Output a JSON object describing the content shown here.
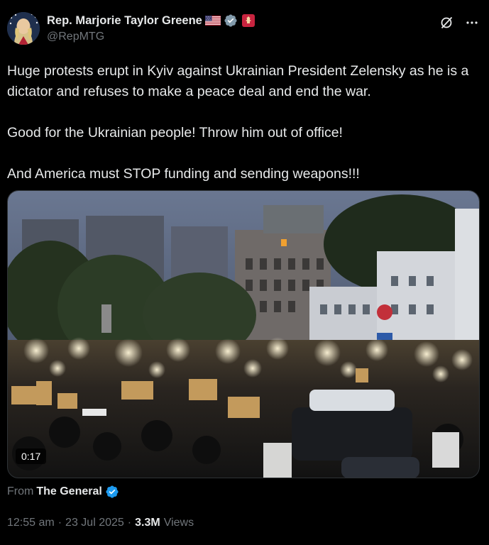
{
  "author": {
    "display_name": "Rep. Marjorie Taylor Greene",
    "handle": "@RepMTG",
    "flag_icon": "us-flag-icon",
    "verified_icon": "gray-verified-badge-icon",
    "affiliate_icon": "house-seal-icon"
  },
  "actions": {
    "grok_icon": "grok-icon",
    "more_icon": "more-icon"
  },
  "tweet": {
    "paragraphs": [
      "Huge protests erupt in Kyiv against Ukrainian President Zelensky as he is a dictator and refuses to make a peace deal and end the war.",
      "Good for the Ukrainian people! Throw him out of office!",
      "And America must STOP funding and sending weapons!!!"
    ]
  },
  "media": {
    "type": "video",
    "duration": "0:17"
  },
  "source": {
    "from_label": "From",
    "name": "The General",
    "verified_icon": "blue-verified-badge-icon"
  },
  "meta": {
    "time": "12:55 am",
    "separator": "·",
    "date": "23 Jul 2025",
    "views_count": "3.3M",
    "views_label": "Views"
  },
  "colors": {
    "background": "#000000",
    "text": "#e7e9ea",
    "secondary": "#71767b",
    "verified_blue": "#1d9bf0",
    "verified_gray": "#829aab",
    "seal_red": "#e0245e"
  }
}
